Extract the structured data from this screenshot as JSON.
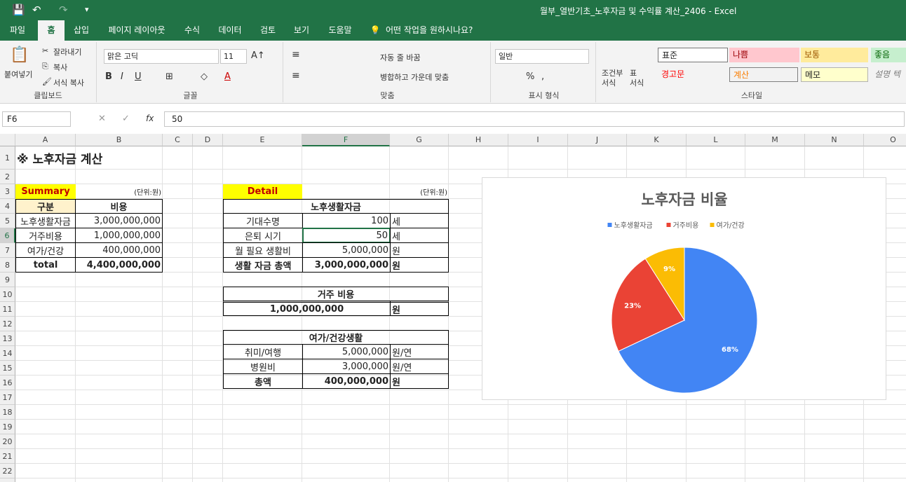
{
  "window": {
    "title": "월부_열반기초_노후자금 및 수익률 계산_2406  -  Excel",
    "save_icon": "💾",
    "undo_icon": "↶",
    "redo_icon": "↷",
    "customize_icon": "▾"
  },
  "tabs": [
    "파일",
    "홈",
    "삽입",
    "페이지 레이아웃",
    "수식",
    "데이터",
    "검토",
    "보기",
    "도움말",
    "어떤 작업을 원하시나요?"
  ],
  "ribbon": {
    "clipboard": {
      "label": "클립보드",
      "paste": "붙여넣기",
      "cut": "잘라내기",
      "copy": "복사",
      "format_painter": "서식 복사"
    },
    "font": {
      "label": "글꼴",
      "font_name": "맑은 고딕",
      "font_size": "11"
    },
    "alignment": {
      "label": "맞춤",
      "wrap": "자동 줄 바꿈",
      "merge": "병합하고 가운데 맞춤"
    },
    "number": {
      "label": "표시 형식",
      "format": "일반"
    },
    "styles": {
      "label": "스타일",
      "conditional": "조건부\n서식",
      "table": "표\n서식",
      "cells": [
        "표준",
        "나쁨",
        "보통",
        "좋음",
        "경고문",
        "계산",
        "메모",
        "설명 텍"
      ]
    }
  },
  "formula_bar": {
    "name_box": "F6",
    "value": "50"
  },
  "columns": [
    "A",
    "B",
    "C",
    "D",
    "E",
    "F",
    "G",
    "H",
    "I",
    "J",
    "K",
    "L",
    "M",
    "N",
    "O"
  ],
  "rows": [
    "1",
    "2",
    "3",
    "4",
    "5",
    "6",
    "7",
    "8",
    "9",
    "10",
    "11",
    "12",
    "13",
    "14",
    "15",
    "16",
    "17",
    "18",
    "19",
    "20",
    "21",
    "22",
    "23"
  ],
  "sheet": {
    "title": "※ 노후자금 계산",
    "summary": {
      "tag": "Summary",
      "unit": "(단위:원)",
      "headers": [
        "구분",
        "비용"
      ],
      "rows": [
        [
          "노후생활자금",
          "3,000,000,000"
        ],
        [
          "거주비용",
          "1,000,000,000"
        ],
        [
          "여가/건강",
          "400,000,000"
        ]
      ],
      "total_label": "total",
      "total_value": "4,400,000,000"
    },
    "detail": {
      "tag": "Detail",
      "unit": "(단위:원)",
      "living": {
        "header": "노후생활자금",
        "rows": [
          [
            "기대수명",
            "100",
            "세"
          ],
          [
            "은퇴 시기",
            "50",
            "세"
          ],
          [
            "월 필요 생활비",
            "5,000,000",
            "원"
          ]
        ],
        "total": [
          "생활 자금 총액",
          "3,000,000,000",
          "원"
        ]
      },
      "housing": {
        "header": "거주 비용",
        "value": "1,000,000,000",
        "unit": "원"
      },
      "leisure": {
        "header": "여가/건강생활",
        "rows": [
          [
            "취미/여행",
            "5,000,000",
            "원/연"
          ],
          [
            "병원비",
            "3,000,000",
            "원/연"
          ]
        ],
        "total": [
          "총액",
          "400,000,000",
          "원"
        ]
      }
    }
  },
  "chart_data": {
    "type": "pie",
    "title": "노후자금 비율",
    "categories": [
      "노후생활자금",
      "거주비용",
      "여가/건강"
    ],
    "values": [
      68,
      23,
      9
    ],
    "labels": [
      "68%",
      "23%",
      "9%"
    ],
    "colors": [
      "#4285f4",
      "#ea4335",
      "#fbbc04"
    ],
    "legend": "top"
  }
}
